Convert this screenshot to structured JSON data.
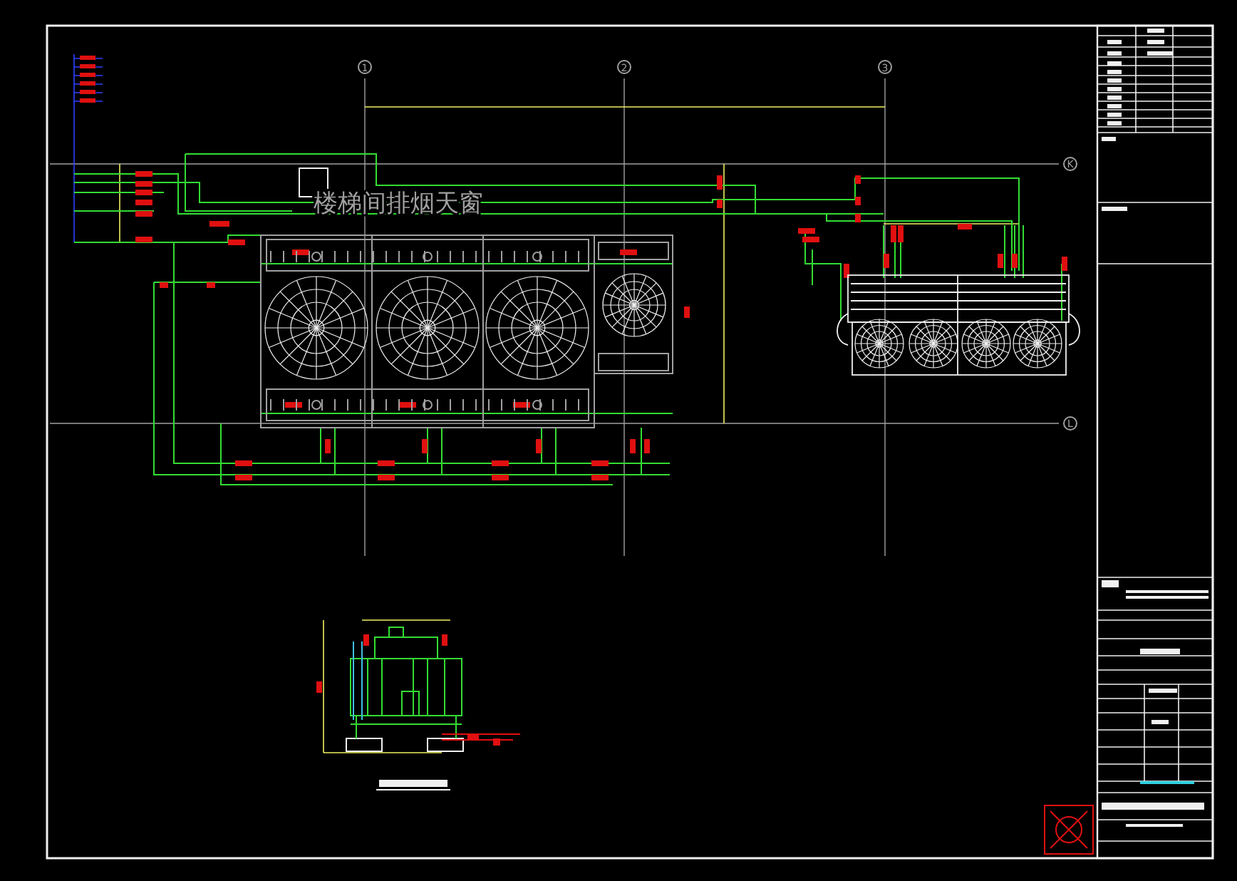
{
  "drawing": {
    "annotation": "楼梯间排烟天窗",
    "column_axes": [
      {
        "label": "1"
      },
      {
        "label": "2"
      },
      {
        "label": "3"
      }
    ],
    "row_axes": [
      {
        "label": "K"
      },
      {
        "label": "L"
      }
    ]
  }
}
